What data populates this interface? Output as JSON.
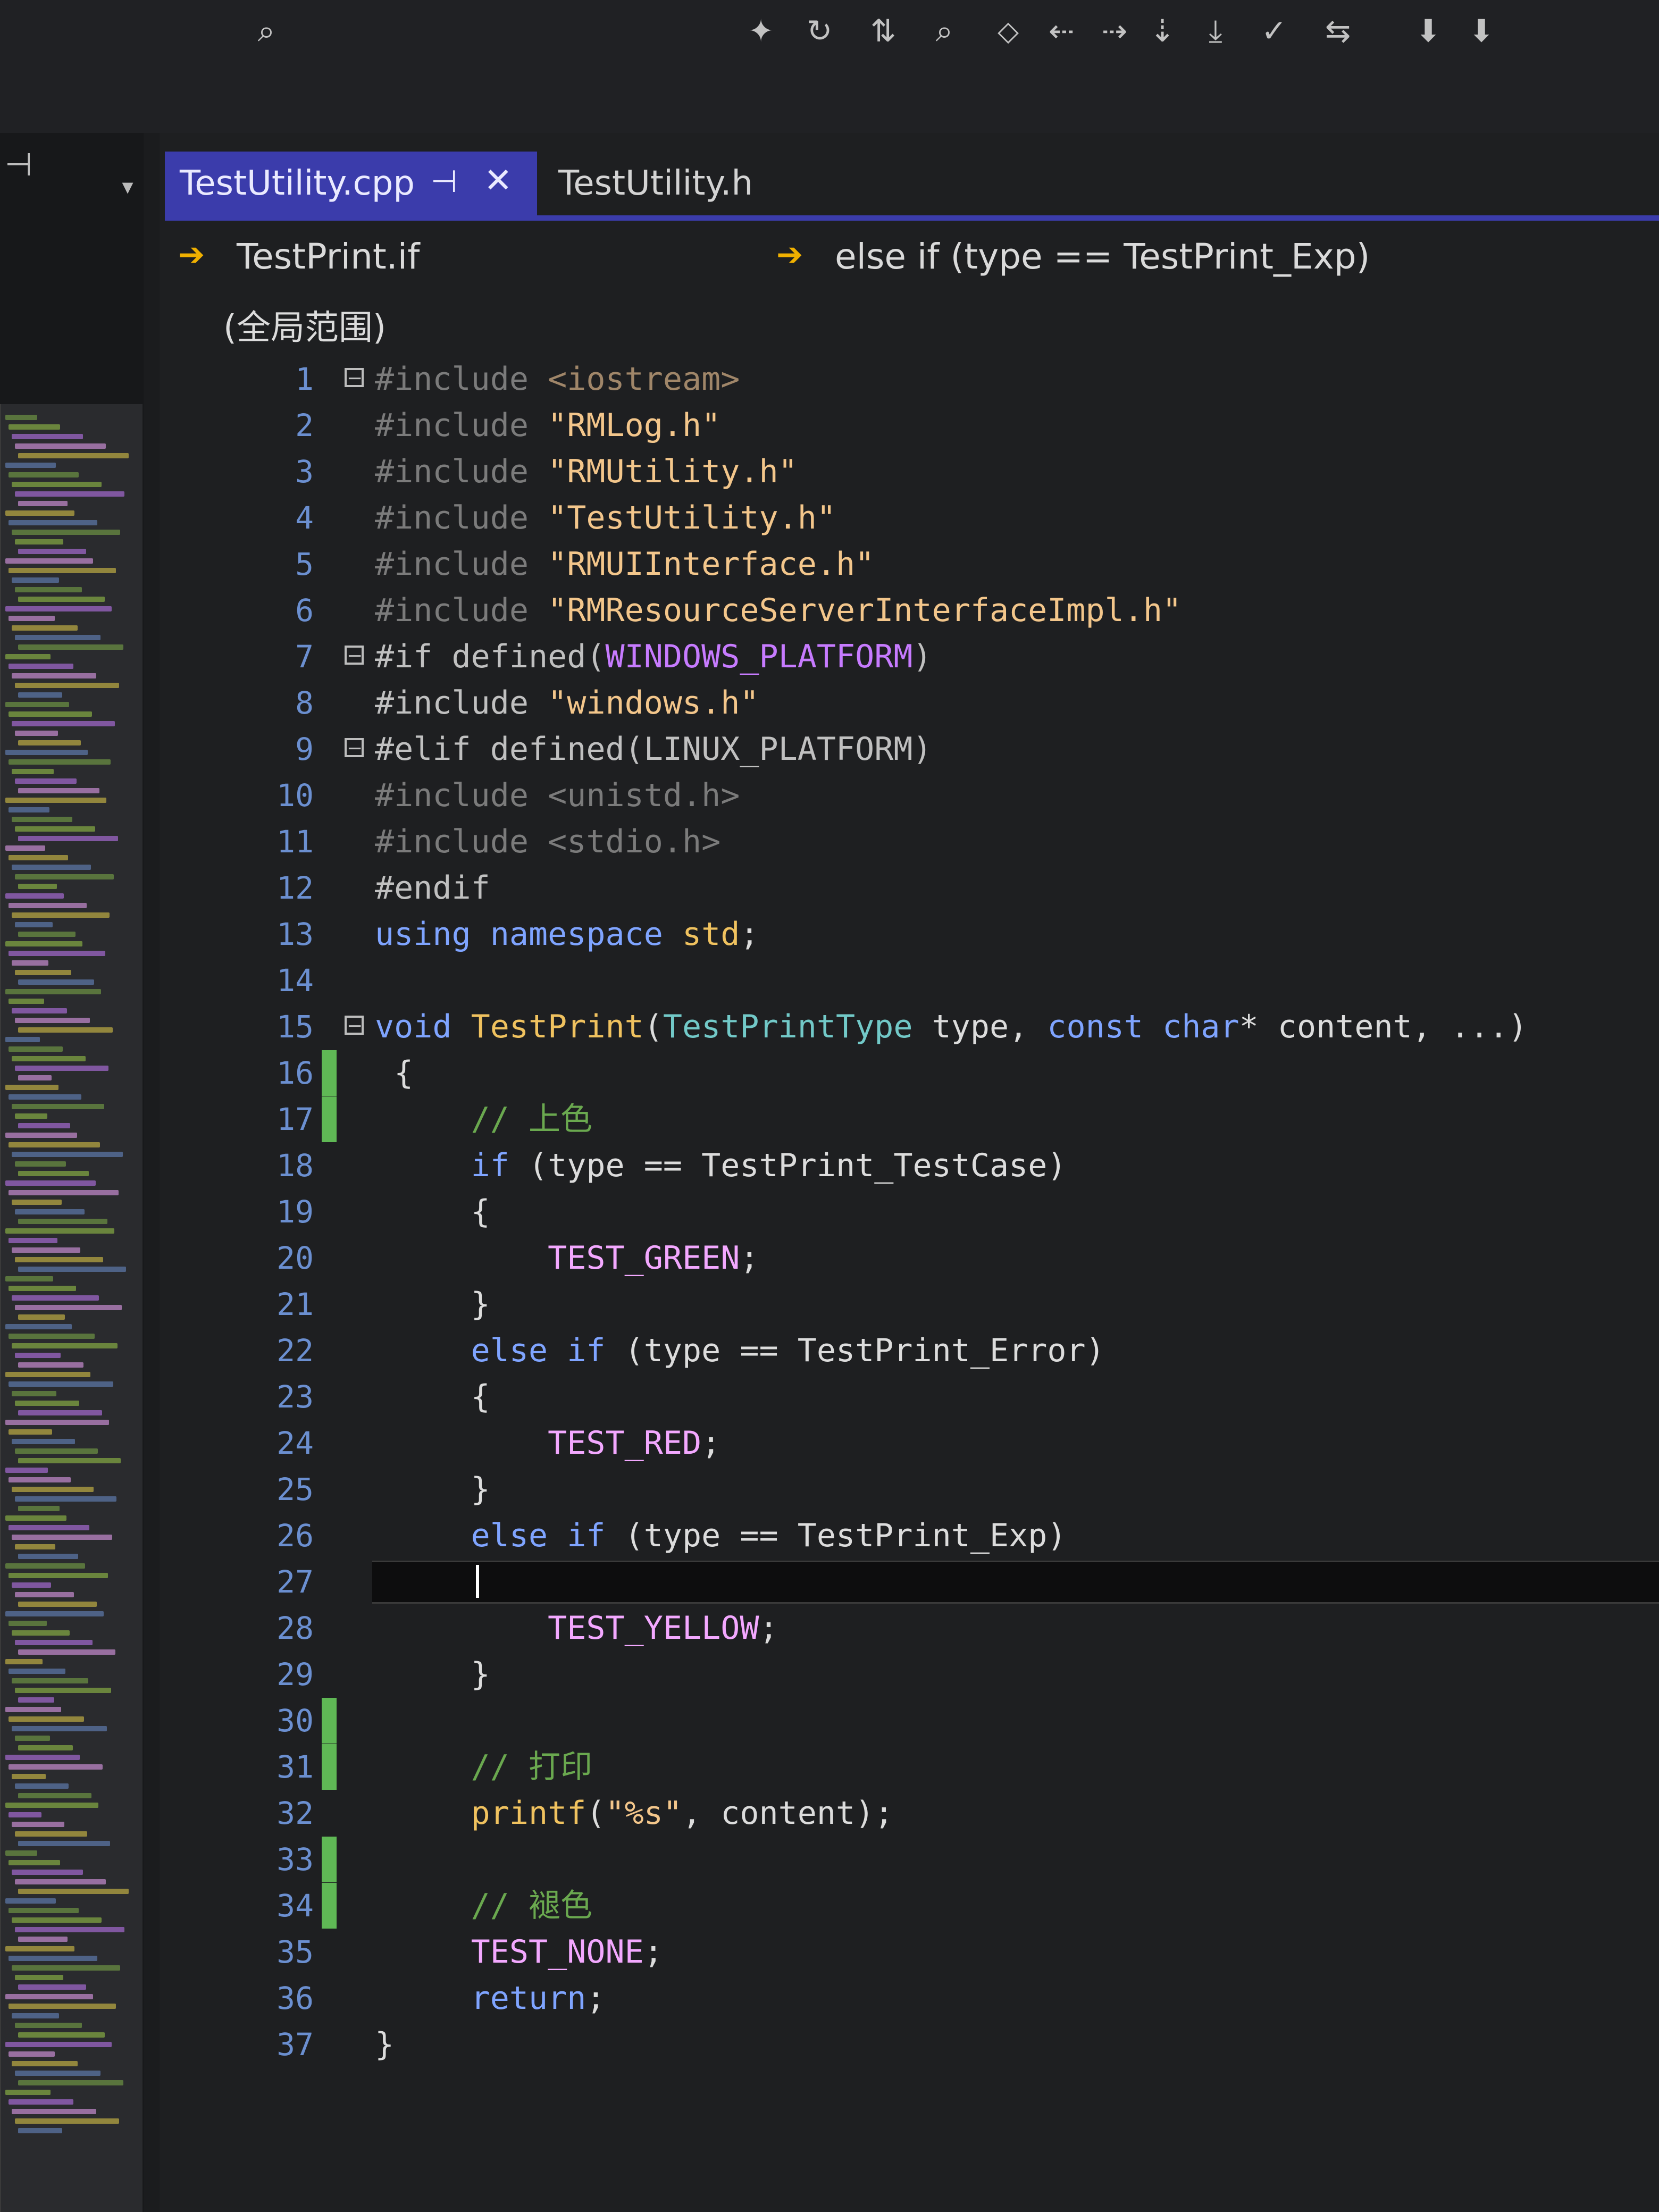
{
  "toolbar": {
    "icons": [
      "find-icon",
      "bookmark-icon",
      "redo-icon",
      "sort-icon",
      "search-replace-icon",
      "zoom-icon",
      "prev-bookmark-icon",
      "next-bookmark-icon",
      "clear-bookmarks-icon",
      "download-icon",
      "spellcheck-icon",
      "move-icon",
      "import-icon",
      "export-icon"
    ]
  },
  "tabs": {
    "active": "TestUtility.cpp",
    "pin_glyph": "⊣",
    "close_glyph": "✕",
    "second": "TestUtility.h"
  },
  "nav": {
    "left": "TestPrint.if",
    "right": "else if (type == TestPrint_Exp)",
    "arrow_glyph": "➔"
  },
  "scope": "(全局范围)",
  "lines": [
    {
      "n": "1",
      "html": "<span class='pp-dim'>#include </span><span class='str-dim'>&lt;iostream&gt;</span>"
    },
    {
      "n": "2",
      "html": "<span class='pp-dim'>#include </span><span class='str'>\"RMLog.h\"</span>"
    },
    {
      "n": "3",
      "html": "<span class='pp-dim'>#include </span><span class='str'>\"RMUtility.h\"</span>"
    },
    {
      "n": "4",
      "html": "<span class='pp-dim'>#include </span><span class='str'>\"TestUtility.h\"</span>"
    },
    {
      "n": "5",
      "html": "<span class='pp-dim'>#include </span><span class='str'>\"RMUIInterface.h\"</span>"
    },
    {
      "n": "6",
      "html": "<span class='pp-dim'>#include </span><span class='str'>\"RMResourceServerInterfaceImpl.h\"</span>"
    },
    {
      "n": "7",
      "html": "<span class='pp'>#if defined(</span><span class='macro-purple'>WINDOWS_PLATFORM</span><span class='pp'>)</span>"
    },
    {
      "n": "8",
      "html": "<span class='pp'>#include </span><span class='str'>\"windows.h\"</span>"
    },
    {
      "n": "9",
      "html": "<span class='pp'>#elif defined(LINUX_PLATFORM)</span>"
    },
    {
      "n": "10",
      "html": "<span class='pp-dim'>#include &lt;unistd.h&gt;</span>"
    },
    {
      "n": "11",
      "html": "<span class='pp-dim'>#include &lt;stdio.h&gt;</span>"
    },
    {
      "n": "12",
      "html": "<span class='pp'>#endif</span>"
    },
    {
      "n": "13",
      "html": "<span class='kw'>using namespace</span> <span class='func'>std</span>;"
    },
    {
      "n": "14",
      "html": ""
    },
    {
      "n": "15",
      "html": "<span class='kw'>void</span> <span class='func'>TestPrint</span>(<span class='type'>TestPrintType</span> type, <span class='kw'>const</span> <span class='kw'>char</span>* content, ...)"
    },
    {
      "n": "16",
      "html": " {"
    },
    {
      "n": "17",
      "html": "     <span class='cmt'>// 上色</span>"
    },
    {
      "n": "18",
      "html": "     <span class='kw'>if</span> (type == TestPrint_TestCase)"
    },
    {
      "n": "19",
      "html": "     {"
    },
    {
      "n": "20",
      "html": "         <span class='macro-pink'>TEST_GREEN</span>;"
    },
    {
      "n": "21",
      "html": "     }"
    },
    {
      "n": "22",
      "html": "     <span class='kw'>else if</span> (type == TestPrint_Error)"
    },
    {
      "n": "23",
      "html": "     {"
    },
    {
      "n": "24",
      "html": "         <span class='macro-pink'>TEST_RED</span>;"
    },
    {
      "n": "25",
      "html": "     }"
    },
    {
      "n": "26",
      "html": "     <span class='kw'>else if</span> (type == TestPrint_Exp)"
    },
    {
      "n": "27",
      "html": "     {"
    },
    {
      "n": "28",
      "html": "         <span class='macro-pink'>TEST_YELLOW</span>;"
    },
    {
      "n": "29",
      "html": "     }"
    },
    {
      "n": "30",
      "html": ""
    },
    {
      "n": "31",
      "html": "     <span class='cmt'>// 打印</span>"
    },
    {
      "n": "32",
      "html": "     <span class='func'>printf</span>(<span class='str'>\"%s\"</span>, content);"
    },
    {
      "n": "33",
      "html": ""
    },
    {
      "n": "34",
      "html": "     <span class='cmt'>// 褪色</span>"
    },
    {
      "n": "35",
      "html": "     <span class='macro-pink'>TEST_NONE</span>;"
    },
    {
      "n": "36",
      "html": "     <span class='kw'>return</span>;"
    },
    {
      "n": "37",
      "html": "}"
    }
  ],
  "folds": [
    "1",
    "7",
    "9",
    "15"
  ],
  "changed": [
    "16",
    "17",
    "30",
    "31",
    "33",
    "34"
  ],
  "current_line": "27"
}
